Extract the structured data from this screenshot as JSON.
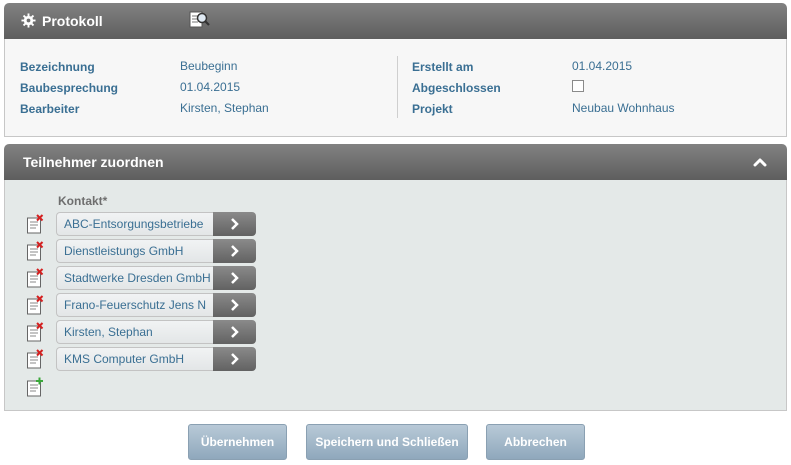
{
  "protocol_panel": {
    "title": "Protokoll",
    "fields_left": [
      {
        "label": "Bezeichnung",
        "value": "Beubeginn"
      },
      {
        "label": "Baubesprechung",
        "value": "01.04.2015"
      },
      {
        "label": "Bearbeiter",
        "value": "Kirsten, Stephan"
      }
    ],
    "fields_right": [
      {
        "label": "Erstellt am",
        "value": "01.04.2015"
      },
      {
        "label": "Abgeschlossen",
        "value": ""
      },
      {
        "label": "Projekt",
        "value": "Neubau Wohnhaus"
      }
    ],
    "abgeschlossen_checked": false
  },
  "participants_panel": {
    "title": "Teilnehmer zuordnen",
    "contact_label": "Kontakt*",
    "contacts": [
      "ABC-Entsorgungsbetriebe",
      "Dienstleistungs GmbH",
      "Stadtwerke Dresden GmbH",
      "Frano-Feuerschutz Jens N",
      "Kirsten, Stephan",
      "KMS Computer GmbH"
    ]
  },
  "buttons": {
    "apply": "Übernehmen",
    "save_close": "Speichern und Schließen",
    "cancel": "Abbrechen"
  },
  "icons": {
    "header": [
      "gear-icon",
      "report-search-icon",
      "collapse-up-icon"
    ],
    "row_delete": "delete-row-icon",
    "row_add": "add-row-icon"
  },
  "colors": {
    "header_bg": "#6f6f6f",
    "text_blue": "#3a6f93",
    "panel_bg": "#e4e9e8",
    "button_bg": "#a3b7c7",
    "delete_red": "#d42020",
    "add_green": "#3aa83a"
  }
}
